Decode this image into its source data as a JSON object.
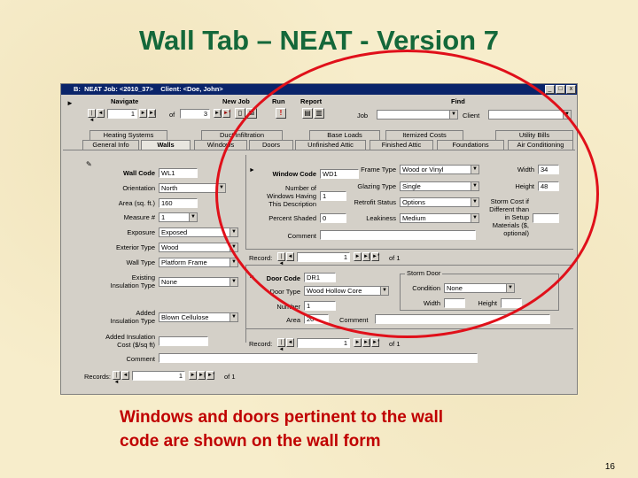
{
  "slide": {
    "title": "Wall Tab – NEAT - Version 7",
    "caption_line1": "Windows and doors pertinent to the wall",
    "caption_line2": "code are shown on the wall form",
    "page_number": "16"
  },
  "window": {
    "title": "B:  NEAT Job: <2010_37>    Client: <Doe, John>",
    "min": "_",
    "max": "□",
    "close": "x"
  },
  "toolbar": {
    "navigate": "Navigate",
    "new_job": "New Job",
    "run": "Run",
    "report": "Report",
    "find": "Find",
    "of_label": "of",
    "of_value": "3",
    "record_value": "1",
    "job_label": "Job",
    "client_label": "Client",
    "job_value": "",
    "client_value": ""
  },
  "tabs_row1": [
    "Heating Systems",
    "Duct Infiltration",
    "Base Loads",
    "Itemized Costs",
    "Utility Bills"
  ],
  "tabs_row2": [
    "General Info",
    "Walls",
    "Windows",
    "Doors",
    "Unfinished Attic",
    "Finished Attic",
    "Foundations",
    "Air Conditioning"
  ],
  "wall": {
    "code_label": "Wall Code",
    "code": "WL1",
    "orientation_label": "Orientation",
    "orientation": "North",
    "area_label": "Area (sq. ft.)",
    "area": "160",
    "measure_label": "Measure #",
    "measure": "1",
    "exposure_label": "Exposure",
    "exposure": "Exposed",
    "ext_type_label": "Exterior Type",
    "ext_type": "Wood",
    "wall_type_label": "Wall Type",
    "wall_type": "Platform Frame",
    "exist_ins_label1": "Existing",
    "exist_ins_label2": "Insulation Type",
    "exist_ins": "None",
    "added_ins_label1": "Added",
    "added_ins_label2": "Insulation Type",
    "added_ins": "Blown Cellulose",
    "added_cost_label1": "Added Insulation",
    "added_cost_label2": "Cost ($/sq ft)",
    "added_cost": "",
    "comment_label": "Comment",
    "comment": "",
    "records_label": "Records:",
    "records_value": "1",
    "records_of": "of 1"
  },
  "window_sub": {
    "code_label": "Window Code",
    "code": "WD1",
    "number_label1": "Number of",
    "number_label2": "Windows Having",
    "number_label3": "This Description",
    "number": "1",
    "percent_label": "Percent Shaded",
    "percent": "0",
    "frame_label": "Frame Type",
    "frame": "Wood or Vinyl",
    "glazing_label": "Glazing Type",
    "glazing": "Single",
    "retrofit_label": "Retrofit Status",
    "retrofit": "Options",
    "leakiness_label": "Leakiness",
    "leakiness": "Medium",
    "width_label": "Width",
    "width": "34",
    "height_label": "Height",
    "height": "48",
    "storm_label1": "Storm Cost if",
    "storm_label2": "Different than",
    "storm_label3": "in Setup",
    "storm_label4": "Materials ($,",
    "storm_label5": "optional)",
    "storm": "",
    "comment_label": "Comment",
    "comment": "",
    "record_label": "Record:",
    "record_value": "1",
    "record_of": "of 1"
  },
  "door_sub": {
    "code_label": "Door Code",
    "code": "DR1",
    "type_label": "Door Type",
    "type": "Wood Hollow Core",
    "number_label": "Number",
    "number": "1",
    "area_label": "Area",
    "area": "20",
    "comment_label": "Comment",
    "comment": "",
    "storm_group": "Storm Door",
    "condition_label": "Condition",
    "condition": "None",
    "width_label": "Width",
    "height_label": "Height",
    "record_label": "Record:",
    "record_value": "1",
    "record_of": "of 1"
  },
  "nav": {
    "first": "|◄",
    "prev": "◄",
    "next": "►",
    "last": "►|",
    "new": "►*"
  }
}
